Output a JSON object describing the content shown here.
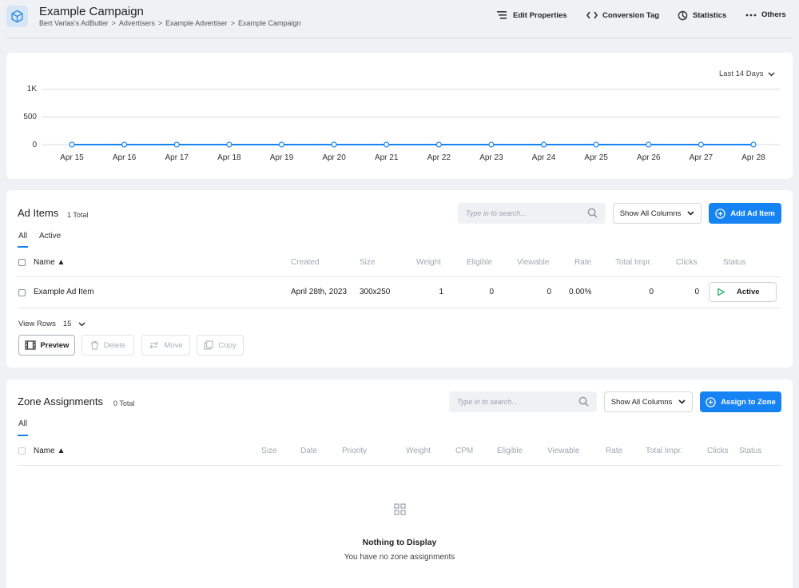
{
  "header": {
    "title": "Example Campaign",
    "breadcrumb": [
      "Bert Varlas's AdButler",
      "Advertisers",
      "Example Advertiser",
      "Example Campaign"
    ],
    "breadcrumb_sep": ">",
    "actions": [
      {
        "label": "Edit Properties",
        "icon": "list-icon"
      },
      {
        "label": "Conversion Tag",
        "icon": "code-icon"
      },
      {
        "label": "Statistics",
        "icon": "pie-icon"
      },
      {
        "label": "Others",
        "icon": "dots-icon"
      }
    ]
  },
  "chart_data": {
    "type": "line",
    "categories": [
      "Apr 15",
      "Apr 16",
      "Apr 17",
      "Apr 18",
      "Apr 19",
      "Apr 20",
      "Apr 21",
      "Apr 22",
      "Apr 23",
      "Apr 24",
      "Apr 25",
      "Apr 26",
      "Apr 27",
      "Apr 28"
    ],
    "series": [
      {
        "values": [
          0,
          0,
          0,
          0,
          0,
          0,
          0,
          0,
          0,
          0,
          0,
          0,
          0,
          0
        ]
      }
    ],
    "yticks": [
      "1K",
      "500",
      "0"
    ],
    "ylim": [
      0,
      1000
    ],
    "grid": true,
    "color": "#1683f5",
    "range_label": "Last 14 Days"
  },
  "ad_items": {
    "title": "Ad Items",
    "count": "1 Total",
    "search_placeholder": "Type in to search...",
    "columns_btn": "Show All Columns",
    "add_btn": "Add Ad Item",
    "tabs": [
      "All",
      "Active"
    ],
    "headers": [
      "Name",
      "Created",
      "Size",
      "Weight",
      "Eligible",
      "Viewable",
      "Rate",
      "Total Impr.",
      "Clicks",
      "Status"
    ],
    "rows": [
      {
        "name": "Example Ad Item",
        "created": "April 28th, 2023",
        "size": "300x250",
        "weight": "1",
        "eligible": "0",
        "viewable": "0",
        "rate": "0.00%",
        "total": "0",
        "clicks": "0",
        "status": "Active"
      }
    ],
    "view_rows_label": "View Rows",
    "view_rows_value": "15",
    "tools": [
      "Preview",
      "Delete",
      "Move",
      "Copy"
    ]
  },
  "zones": {
    "title": "Zone Assignments",
    "count": "0 Total",
    "search_placeholder": "Type in to search...",
    "columns_btn": "Show All Columns",
    "assign_btn": "Assign to Zone",
    "tabs": [
      "All"
    ],
    "headers": [
      "Name",
      "Size",
      "Date",
      "Priority",
      "Weight",
      "CPM",
      "Eligible",
      "Viewable",
      "Rate",
      "Total Impr.",
      "Clicks",
      "Status"
    ],
    "empty_title": "Nothing to Display",
    "empty_sub": "You have no zone assignments"
  }
}
